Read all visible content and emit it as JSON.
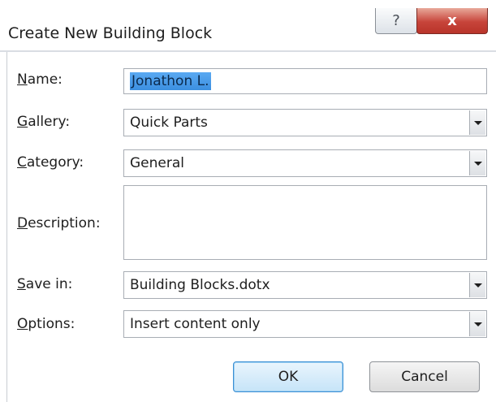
{
  "dialog": {
    "title": "Create New Building Block",
    "help_glyph": "?",
    "close_glyph": "x"
  },
  "form": {
    "name": {
      "label_accel": "N",
      "label_rest": "ame:",
      "value": "Jonathon L."
    },
    "gallery": {
      "label_accel": "G",
      "label_rest": "allery:",
      "value": "Quick Parts"
    },
    "category": {
      "label_accel": "C",
      "label_rest": "ategory:",
      "value": "General"
    },
    "description": {
      "label_accel": "D",
      "label_rest": "escription:",
      "value": ""
    },
    "save_in": {
      "label_accel": "S",
      "label_rest": "ave in:",
      "value": "Building Blocks.dotx"
    },
    "options": {
      "label_accel": "O",
      "label_rest": "ptions:",
      "value": "Insert content only"
    }
  },
  "buttons": {
    "ok": "OK",
    "cancel": "Cancel"
  },
  "colors": {
    "selection": "#3c8fe0",
    "close_button": "#c7443a",
    "ok_border": "#3c8fd3"
  },
  "icons": {
    "help": "question-mark-icon",
    "close": "close-icon",
    "dropdown": "chevron-down-icon"
  }
}
